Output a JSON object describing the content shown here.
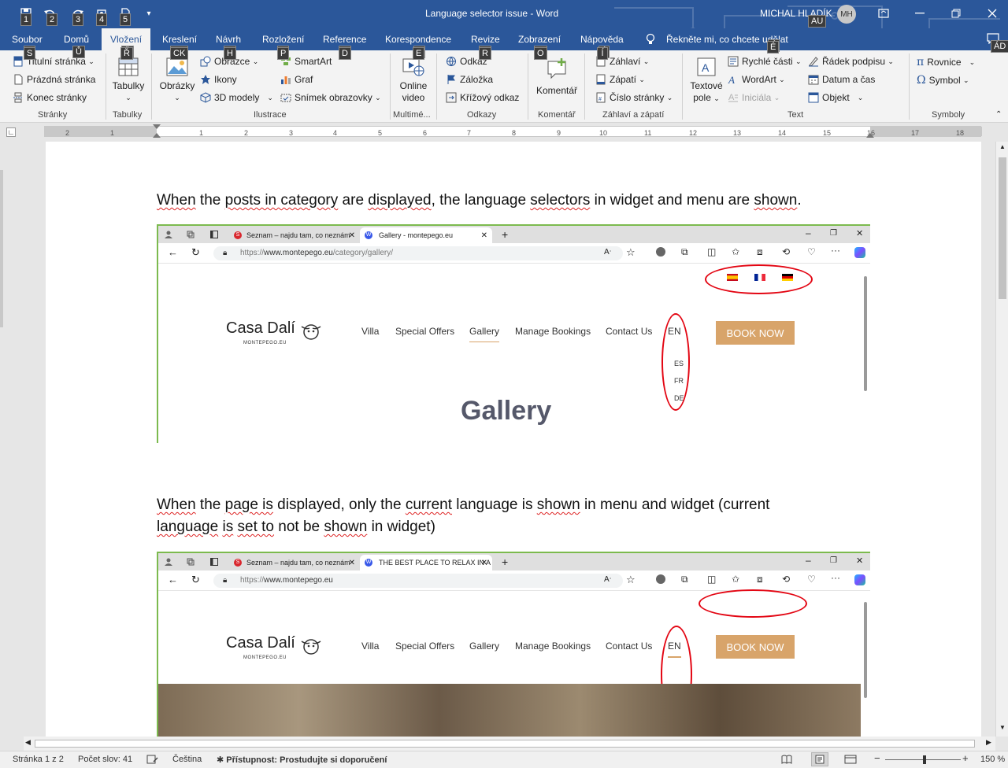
{
  "window": {
    "title": "Language selector issue  -  Word",
    "user": "MICHAL HLADÍK",
    "user_initials": "MH",
    "accent": "#2b579a"
  },
  "quick_access_keytips": [
    "1",
    "2",
    "3",
    "4",
    "5"
  ],
  "tabs": [
    {
      "label": "Soubor",
      "keytip": "S"
    },
    {
      "label": "Domů",
      "keytip": "Ů"
    },
    {
      "label": "Vložení",
      "keytip": "Ř",
      "active": true
    },
    {
      "label": "Kreslení",
      "keytip": "CK"
    },
    {
      "label": "Návrh",
      "keytip": "H"
    },
    {
      "label": "Rozložení",
      "keytip": "P"
    },
    {
      "label": "Reference",
      "keytip": "D"
    },
    {
      "label": "Korespondence",
      "keytip": "E"
    },
    {
      "label": "Revize",
      "keytip": "R"
    },
    {
      "label": "Zobrazení",
      "keytip": "O"
    },
    {
      "label": "Nápověda",
      "keytip": "Í"
    }
  ],
  "tell_me": {
    "text": "Řekněte mi, co chcete udělat",
    "keytip": "É"
  },
  "extra_keytips": [
    "AU",
    "ÁD"
  ],
  "ribbon": {
    "pages": {
      "group": "Stránky",
      "items": [
        "Titulní stránka",
        "Prázdná stránka",
        "Konec stránky"
      ]
    },
    "tables": {
      "group": "Tabulky",
      "label": "Tabulky"
    },
    "illustrations": {
      "group": "Ilustrace",
      "pictures": "Obrázky",
      "shapes": "Obrazce",
      "icons": "Ikony",
      "models": "3D modely",
      "smartart": "SmartArt",
      "chart": "Graf",
      "screenshot": "Snímek obrazovky"
    },
    "media": {
      "group": "Multimé...",
      "online1": "Online",
      "online2": "video"
    },
    "links": {
      "group": "Odkazy",
      "link": "Odkaz",
      "bookmark": "Záložka",
      "cross": "Křížový odkaz"
    },
    "comments": {
      "group": "Komentář",
      "label": "Komentář"
    },
    "headerfooter": {
      "group": "Záhlaví a zápatí",
      "header": "Záhlaví",
      "footer": "Zápatí",
      "pagenum": "Číslo stránky"
    },
    "text": {
      "group": "Text",
      "textbox1": "Textové",
      "textbox2": "pole",
      "quickparts": "Rychlé části",
      "wordart": "WordArt",
      "dropcap": "Iniciála",
      "sigline": "Řádek podpisu",
      "datetime": "Datum a čas",
      "object": "Objekt"
    },
    "symbols": {
      "group": "Symboly",
      "equation": "Rovnice",
      "symbol": "Symbol"
    }
  },
  "ruler_ticks": [
    "2",
    "1",
    "1",
    "2",
    "3",
    "4",
    "5",
    "6",
    "7",
    "8",
    "9",
    "10",
    "11",
    "12",
    "13",
    "14",
    "15",
    "16",
    "17",
    "18"
  ],
  "document": {
    "para1": "When the posts in category are displayed, the language selectors in widget and menu are shown.",
    "para2_line1": "When the page is displayed, only the current language is shown in menu and widget (current",
    "para2_line2": "language is set to not be shown in widget)"
  },
  "shot1": {
    "tab1": "Seznam – najdu tam, co neznám",
    "tab2": "Gallery - montepego.eu",
    "url_scheme": "https://",
    "url_host": "www.montepego.eu",
    "url_path": "/category/gallery/",
    "logo": "Casa Dalí",
    "logo_sub": "MONTEPEGO.EU",
    "nav": [
      "Villa",
      "Special Offers",
      "Gallery",
      "Manage Bookings",
      "Contact Us"
    ],
    "current_lang": "EN",
    "dropdown": [
      "ES",
      "FR",
      "DE"
    ],
    "book": "BOOK NOW",
    "heading": "Gallery"
  },
  "shot2": {
    "tab1": "Seznam – najdu tam, co neznám",
    "tab2": "THE BEST PLACE TO RELAX IN A",
    "url_scheme": "https://",
    "url_host": "www.montepego.eu",
    "logo": "Casa Dalí",
    "logo_sub": "MONTEPEGO.EU",
    "nav": [
      "Villa",
      "Special Offers",
      "Gallery",
      "Manage Bookings",
      "Contact Us"
    ],
    "current_lang": "EN",
    "book": "BOOK NOW"
  },
  "status": {
    "page": "Stránka 1 z 2",
    "words": "Počet slov: 41",
    "language": "Čeština",
    "accessibility": "Přístupnost: Prostudujte si doporučení",
    "zoom": "150 %"
  }
}
